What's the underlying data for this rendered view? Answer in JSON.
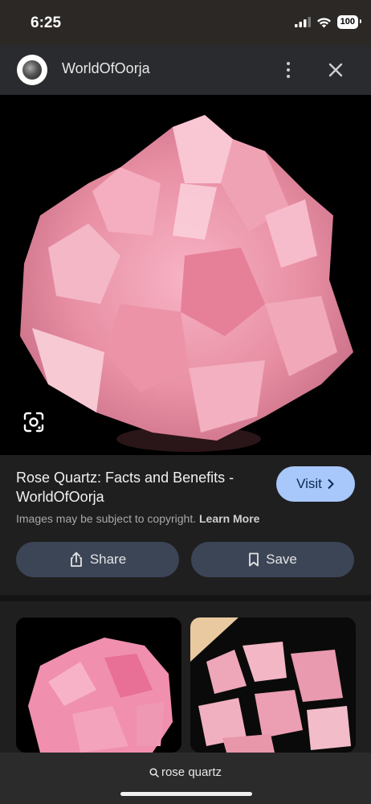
{
  "status_bar": {
    "time": "6:25",
    "battery": "100"
  },
  "header": {
    "site_name": "WorldOfOorja",
    "icons": [
      "more-vert-icon",
      "close-icon"
    ]
  },
  "result": {
    "title": "Rose Quartz: Facts and Benefits - WorldOfOorja",
    "visit_label": "Visit",
    "copyright_text": "Images may be subject to copyright.",
    "learn_more": "Learn More",
    "share_label": "Share",
    "save_label": "Save"
  },
  "search": {
    "query": "rose quartz"
  },
  "colors": {
    "accent": "#a8c7fa",
    "button_bg": "#3c4556",
    "background": "#1f1f1f"
  }
}
